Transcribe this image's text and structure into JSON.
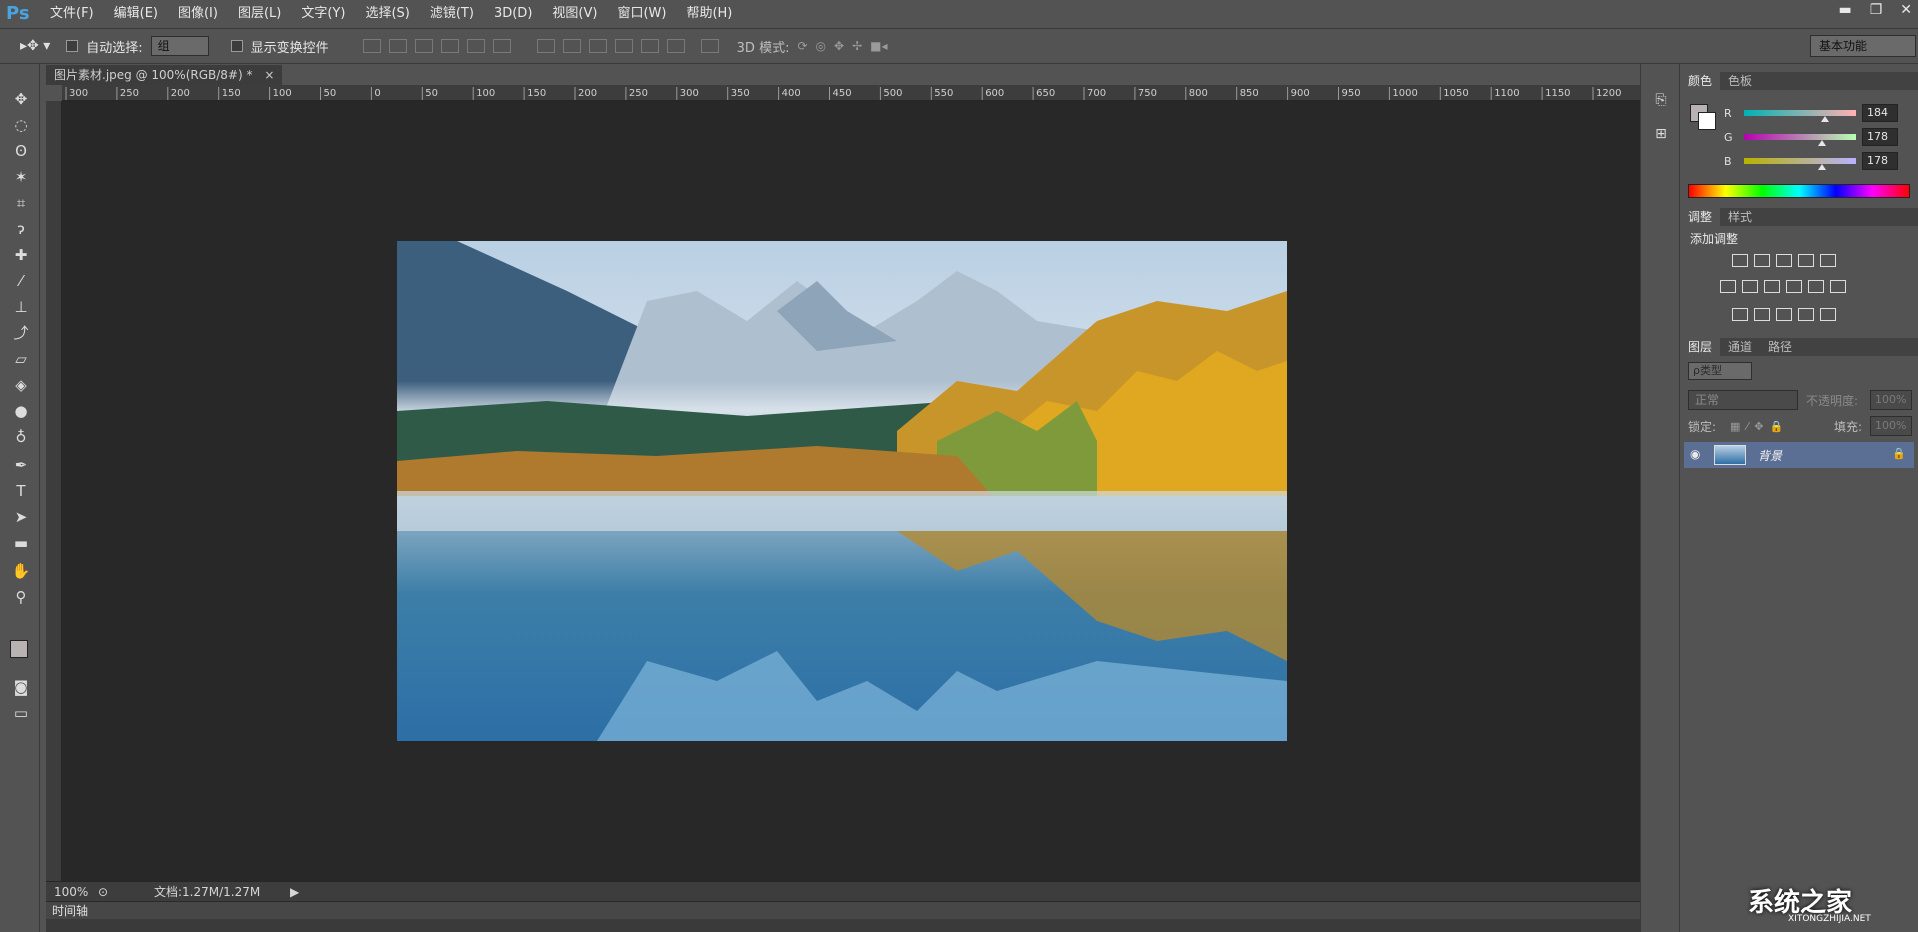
{
  "app": {
    "logo": "Ps"
  },
  "menu": [
    "文件(F)",
    "编辑(E)",
    "图像(I)",
    "图层(L)",
    "文字(Y)",
    "选择(S)",
    "滤镜(T)",
    "3D(D)",
    "视图(V)",
    "窗口(W)",
    "帮助(H)"
  ],
  "window_controls": {
    "minimize": "▬",
    "restore": "❐",
    "close": "✕"
  },
  "options": {
    "auto_select_label": "自动选择:",
    "auto_select_value": "组",
    "show_transform_label": "显示变换控件",
    "mode_3d_label": "3D 模式:",
    "workspace": "基本功能"
  },
  "document": {
    "tab_title": "图片素材.jpeg @ 100%(RGB/8#) *",
    "tab_close": "×",
    "zoom": "100%",
    "doc_size": "文档:1.27M/1.27M",
    "ruler_top_labels": [
      "300",
      "250",
      "200",
      "150",
      "100",
      "50",
      "0",
      "50",
      "100",
      "150",
      "200",
      "250",
      "300",
      "350",
      "400",
      "450",
      "500",
      "550",
      "600",
      "650",
      "700",
      "750",
      "800",
      "850",
      "900",
      "950",
      "1000",
      "1050",
      "1100",
      "1150",
      "1200"
    ]
  },
  "timeline": {
    "label": "时间轴"
  },
  "color_panel": {
    "tabs": [
      "颜色",
      "色板"
    ],
    "r_label": "R",
    "g_label": "G",
    "b_label": "B",
    "r": "184",
    "g": "178",
    "b": "178",
    "r_level": 0.72,
    "g_level": 0.7,
    "b_level": 0.7
  },
  "adjust_panel": {
    "tabs": [
      "调整",
      "样式"
    ],
    "title": "添加调整"
  },
  "layers_panel": {
    "tabs": [
      "图层",
      "通道",
      "路径"
    ],
    "filter_label": "ρ类型",
    "blend_mode": "正常",
    "opacity_label": "不透明度:",
    "opacity_value": "100%",
    "lock_label": "锁定:",
    "fill_label": "填充:",
    "fill_value": "100%",
    "layer_name": "背景"
  },
  "watermark": {
    "text": "系统之家",
    "sub": "XITONGZHIJIA.NET"
  },
  "colors": {
    "ui_bg": "#535353",
    "canvas_bg": "#282828",
    "layer_selected": "#5b6f94",
    "logo_blue": "#4aa3df"
  }
}
